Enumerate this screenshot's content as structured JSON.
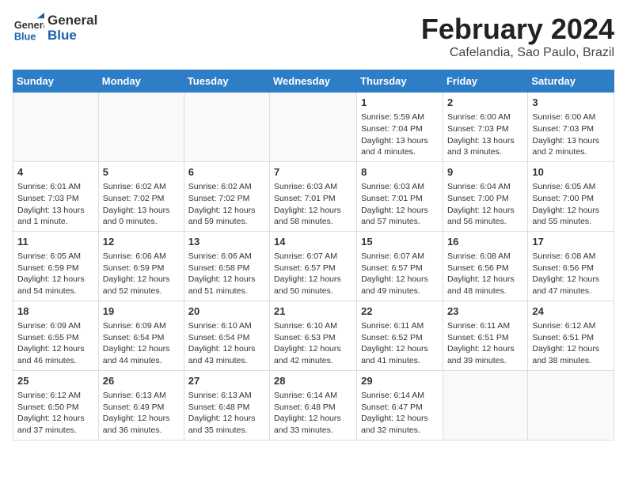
{
  "header": {
    "logo_general": "General",
    "logo_blue": "Blue",
    "main_title": "February 2024",
    "subtitle": "Cafelandia, Sao Paulo, Brazil"
  },
  "weekdays": [
    "Sunday",
    "Monday",
    "Tuesday",
    "Wednesday",
    "Thursday",
    "Friday",
    "Saturday"
  ],
  "weeks": [
    [
      {
        "day": "",
        "info": ""
      },
      {
        "day": "",
        "info": ""
      },
      {
        "day": "",
        "info": ""
      },
      {
        "day": "",
        "info": ""
      },
      {
        "day": "1",
        "info": "Sunrise: 5:59 AM\nSunset: 7:04 PM\nDaylight: 13 hours and 4 minutes."
      },
      {
        "day": "2",
        "info": "Sunrise: 6:00 AM\nSunset: 7:03 PM\nDaylight: 13 hours and 3 minutes."
      },
      {
        "day": "3",
        "info": "Sunrise: 6:00 AM\nSunset: 7:03 PM\nDaylight: 13 hours and 2 minutes."
      }
    ],
    [
      {
        "day": "4",
        "info": "Sunrise: 6:01 AM\nSunset: 7:03 PM\nDaylight: 13 hours and 1 minute."
      },
      {
        "day": "5",
        "info": "Sunrise: 6:02 AM\nSunset: 7:02 PM\nDaylight: 13 hours and 0 minutes."
      },
      {
        "day": "6",
        "info": "Sunrise: 6:02 AM\nSunset: 7:02 PM\nDaylight: 12 hours and 59 minutes."
      },
      {
        "day": "7",
        "info": "Sunrise: 6:03 AM\nSunset: 7:01 PM\nDaylight: 12 hours and 58 minutes."
      },
      {
        "day": "8",
        "info": "Sunrise: 6:03 AM\nSunset: 7:01 PM\nDaylight: 12 hours and 57 minutes."
      },
      {
        "day": "9",
        "info": "Sunrise: 6:04 AM\nSunset: 7:00 PM\nDaylight: 12 hours and 56 minutes."
      },
      {
        "day": "10",
        "info": "Sunrise: 6:05 AM\nSunset: 7:00 PM\nDaylight: 12 hours and 55 minutes."
      }
    ],
    [
      {
        "day": "11",
        "info": "Sunrise: 6:05 AM\nSunset: 6:59 PM\nDaylight: 12 hours and 54 minutes."
      },
      {
        "day": "12",
        "info": "Sunrise: 6:06 AM\nSunset: 6:59 PM\nDaylight: 12 hours and 52 minutes."
      },
      {
        "day": "13",
        "info": "Sunrise: 6:06 AM\nSunset: 6:58 PM\nDaylight: 12 hours and 51 minutes."
      },
      {
        "day": "14",
        "info": "Sunrise: 6:07 AM\nSunset: 6:57 PM\nDaylight: 12 hours and 50 minutes."
      },
      {
        "day": "15",
        "info": "Sunrise: 6:07 AM\nSunset: 6:57 PM\nDaylight: 12 hours and 49 minutes."
      },
      {
        "day": "16",
        "info": "Sunrise: 6:08 AM\nSunset: 6:56 PM\nDaylight: 12 hours and 48 minutes."
      },
      {
        "day": "17",
        "info": "Sunrise: 6:08 AM\nSunset: 6:56 PM\nDaylight: 12 hours and 47 minutes."
      }
    ],
    [
      {
        "day": "18",
        "info": "Sunrise: 6:09 AM\nSunset: 6:55 PM\nDaylight: 12 hours and 46 minutes."
      },
      {
        "day": "19",
        "info": "Sunrise: 6:09 AM\nSunset: 6:54 PM\nDaylight: 12 hours and 44 minutes."
      },
      {
        "day": "20",
        "info": "Sunrise: 6:10 AM\nSunset: 6:54 PM\nDaylight: 12 hours and 43 minutes."
      },
      {
        "day": "21",
        "info": "Sunrise: 6:10 AM\nSunset: 6:53 PM\nDaylight: 12 hours and 42 minutes."
      },
      {
        "day": "22",
        "info": "Sunrise: 6:11 AM\nSunset: 6:52 PM\nDaylight: 12 hours and 41 minutes."
      },
      {
        "day": "23",
        "info": "Sunrise: 6:11 AM\nSunset: 6:51 PM\nDaylight: 12 hours and 39 minutes."
      },
      {
        "day": "24",
        "info": "Sunrise: 6:12 AM\nSunset: 6:51 PM\nDaylight: 12 hours and 38 minutes."
      }
    ],
    [
      {
        "day": "25",
        "info": "Sunrise: 6:12 AM\nSunset: 6:50 PM\nDaylight: 12 hours and 37 minutes."
      },
      {
        "day": "26",
        "info": "Sunrise: 6:13 AM\nSunset: 6:49 PM\nDaylight: 12 hours and 36 minutes."
      },
      {
        "day": "27",
        "info": "Sunrise: 6:13 AM\nSunset: 6:48 PM\nDaylight: 12 hours and 35 minutes."
      },
      {
        "day": "28",
        "info": "Sunrise: 6:14 AM\nSunset: 6:48 PM\nDaylight: 12 hours and 33 minutes."
      },
      {
        "day": "29",
        "info": "Sunrise: 6:14 AM\nSunset: 6:47 PM\nDaylight: 12 hours and 32 minutes."
      },
      {
        "day": "",
        "info": ""
      },
      {
        "day": "",
        "info": ""
      }
    ]
  ]
}
